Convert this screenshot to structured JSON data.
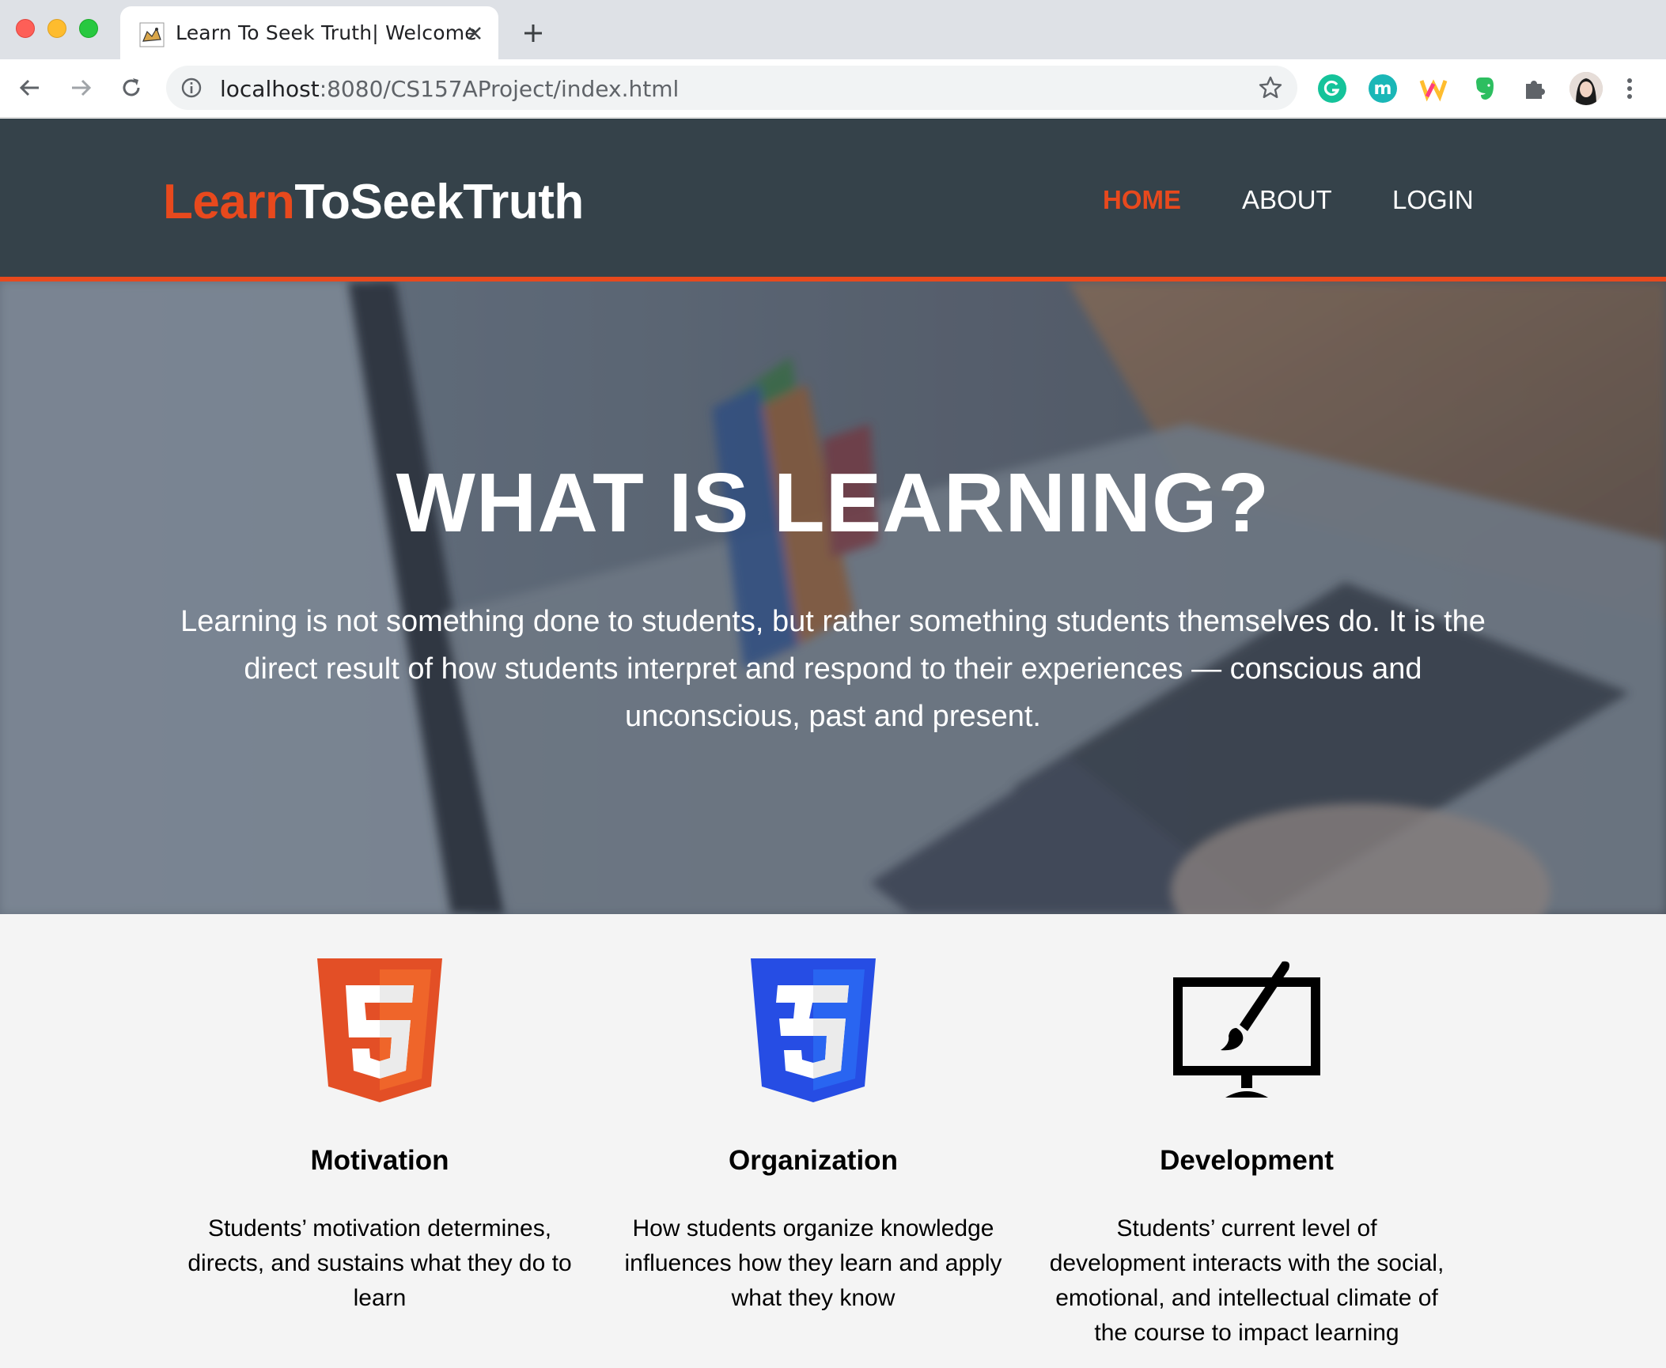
{
  "browser": {
    "tab_title": "Learn To Seek Truth| Welcome",
    "url_host": "localhost",
    "url_rest": ":8080/CS157AProject/index.html",
    "icons": [
      "back-arrow-icon",
      "forward-arrow-icon",
      "reload-icon",
      "info-icon",
      "star-icon",
      "grammarly-icon",
      "m-extension-icon",
      "w-extension-icon",
      "evernote-icon",
      "puzzle-icon",
      "profile-avatar",
      "more-menu-icon"
    ]
  },
  "site": {
    "logo_highlight": "Learn",
    "logo_rest": "ToSeekTruth",
    "nav": [
      {
        "label": "HOME",
        "current": true
      },
      {
        "label": "ABOUT",
        "current": false
      },
      {
        "label": "LOGIN",
        "current": false
      }
    ],
    "colors": {
      "header_bg": "#35424a",
      "accent": "#e8491d"
    }
  },
  "showcase": {
    "title": "WHAT IS LEARNING?",
    "text": "Learning is not something done to students, but rather something students themselves do. It is the direct result of how students interpret and respond to their experiences — conscious and unconscious, past and present."
  },
  "boxes": [
    {
      "icon": "html5-logo-icon",
      "title": "Motivation",
      "text": "Students’ motivation determines, directs, and sustains what they do to learn"
    },
    {
      "icon": "css3-logo-icon",
      "title": "Organization",
      "text": "How students organize knowledge influences how they learn and apply what they know"
    },
    {
      "icon": "monitor-brush-icon",
      "title": "Development",
      "text": "Students’ current level of development interacts with the social, emotional, and intellectual climate of the course to impact learning"
    }
  ]
}
